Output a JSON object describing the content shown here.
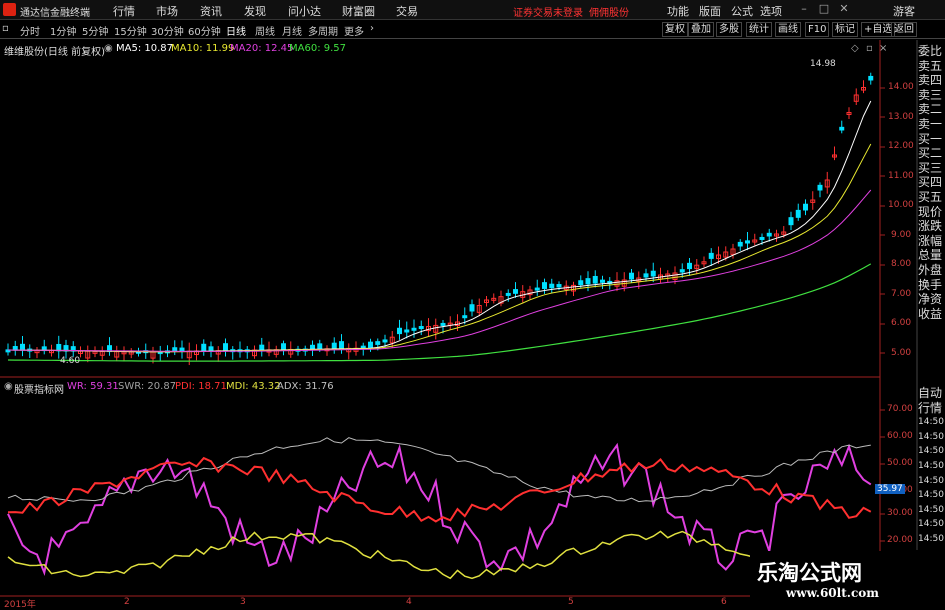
{
  "titlebar": {
    "app_name": "通达信金融终端"
  },
  "menu": [
    "行情",
    "市场",
    "资讯",
    "发现",
    "问小达",
    "财富圈",
    "交易"
  ],
  "warning": "证券交易未登录",
  "warning2": "佣佣股份",
  "right_menu": [
    "功能",
    "版面",
    "公式",
    "选项"
  ],
  "guest": "游客",
  "period_tabs": [
    "分时",
    "1分钟",
    "5分钟",
    "15分钟",
    "30分钟",
    "60分钟",
    "日线",
    "周线",
    "月线",
    "多周期",
    "更多"
  ],
  "active_tab": "日线",
  "toolbar_right": [
    "复权",
    "叠加",
    "多股",
    "统计",
    "画线",
    "F10",
    "标记",
    "+自选",
    "返回"
  ],
  "chart_header": {
    "title": "维维股份(日线 前复权)"
  },
  "ma": [
    {
      "label": "MA5: 10.87",
      "color": "#ffffff"
    },
    {
      "label": "MA10: 11.99",
      "color": "#e8e830"
    },
    {
      "label": "MA20: 12.45",
      "color": "#e040e0"
    },
    {
      "label": "MA60: 9.57",
      "color": "#40e040"
    }
  ],
  "indicator_header": {
    "name": "股票指标网",
    "items": [
      {
        "label": "WR: 59.31",
        "color": "#e040e0"
      },
      {
        "label": "SWR: 20.87",
        "color": "#a0a0a0"
      },
      {
        "label": "PDI: 18.71",
        "color": "#ff3030"
      },
      {
        "label": "MDI: 43.32",
        "color": "#e0e040"
      },
      {
        "label": "ADX: 31.76",
        "color": "#c0c0c0"
      }
    ]
  },
  "right_panel": [
    "委比",
    "卖五",
    "卖四",
    "卖三",
    "卖二",
    "卖一",
    "买一",
    "买二",
    "买三",
    "买四",
    "买五",
    "现价",
    "涨跌",
    "涨幅",
    "总量",
    "外盘",
    "换手",
    "净资",
    "收益"
  ],
  "right_panel2": [
    "自动",
    "行情",
    "14:50",
    "14:50",
    "14:50",
    "14:50",
    "14:50",
    "14:50",
    "14:50",
    "14:50",
    "14:50"
  ],
  "price_axis": [
    "14.00",
    "13.00",
    "12.00",
    "11.00",
    "10.00",
    "9.00",
    "8.00",
    "7.00",
    "6.00",
    "5.00"
  ],
  "indicator_axis": [
    "70.00",
    "60.00",
    "50.00",
    "40.00",
    "30.00",
    "20.00"
  ],
  "indicator_current": "35.97",
  "price_high_label": "14.98",
  "price_low_label": "4.60",
  "x_labels": [
    "2015年",
    "2",
    "3",
    "4",
    "5",
    "6"
  ],
  "watermark": {
    "line1": "乐淘公式网",
    "line2": "www.60lt.com"
  },
  "colors": {
    "up": "#ff3030",
    "down": "#00e0ff",
    "axis": "#a02020"
  }
}
